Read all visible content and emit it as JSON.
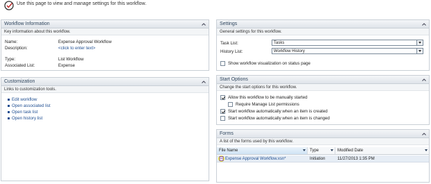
{
  "intro": {
    "text": "Use this page to view and manage settings for this workflow."
  },
  "workflow_information": {
    "title": "Workflow Information",
    "description": "Key information about this workflow.",
    "name_label": "Name:",
    "name_value": "Expense Approval Workflow",
    "description_label": "Description:",
    "description_value": "<click to enter text>",
    "type_label": "Type:",
    "type_value": "List Workflow",
    "associated_list_label": "Associated List:",
    "associated_list_value": "Expense"
  },
  "customization": {
    "title": "Customization",
    "description": "Links to customization tools.",
    "links": [
      "Edit workflow",
      "Open associated list",
      "Open task list",
      "Open history list"
    ]
  },
  "settings": {
    "title": "Settings",
    "description": "General settings for this workflow.",
    "task_list_label": "Task List:",
    "task_list_value": "Tasks",
    "history_list_label": "History List:",
    "history_list_value": "Workflow History",
    "show_visualization_label": "Show workflow visualization on status page",
    "show_visualization_checked": false
  },
  "start_options": {
    "title": "Start Options",
    "description": "Change the start options for this workflow.",
    "options": [
      {
        "label": "Allow this workflow to be manually started",
        "checked": true
      },
      {
        "label": "Require Manage List permissions",
        "checked": false
      },
      {
        "label": "Start workflow automatically when an item is created",
        "checked": true
      },
      {
        "label": "Start workflow automatically when an item is changed",
        "checked": false
      }
    ]
  },
  "forms": {
    "title": "Forms",
    "description": "A list of the forms used by this workflow.",
    "columns": [
      "File Name",
      "Type",
      "Modified Date"
    ],
    "rows": [
      {
        "file_name": "Expense Approval Workflow.xsn*",
        "type": "Initiation",
        "modified": "11/27/2013 1:35 PM"
      }
    ]
  },
  "colors": {
    "accent": "#1f4e91",
    "panel_border": "#c9cfd6",
    "selected_row": "#e6edf5",
    "highlight": "#f3f000"
  }
}
